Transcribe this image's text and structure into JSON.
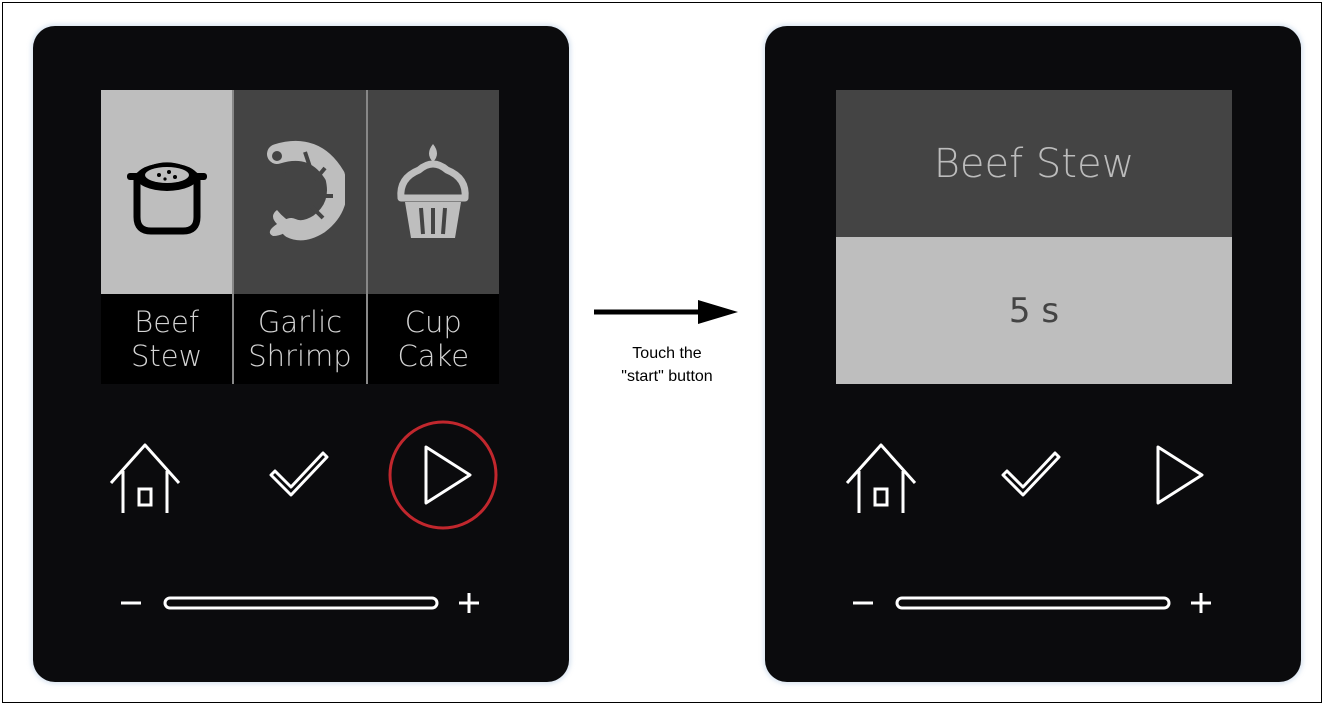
{
  "panel_before": {
    "menu_items": [
      {
        "line1": "Beef",
        "line2": "Stew",
        "icon": "pot-icon",
        "selected": true
      },
      {
        "line1": "Garlic",
        "line2": "Shrimp",
        "icon": "shrimp-icon",
        "selected": false
      },
      {
        "line1": "Cup",
        "line2": "Cake",
        "icon": "cupcake-icon",
        "selected": false
      }
    ],
    "highlighted_button": "start-button"
  },
  "transition": {
    "caption_line1": "Touch the",
    "caption_line2": "\"start\" button"
  },
  "panel_after": {
    "recipe_name": "Beef Stew",
    "remaining_time": "5 s"
  },
  "controls": {
    "buttons": [
      "home-icon",
      "check-icon",
      "play-icon"
    ],
    "slider_minus": "−",
    "slider_plus": "+"
  },
  "colors": {
    "highlight_ring": "#c1272d",
    "selected_tile": "#bebebe",
    "unselected_tile": "#444444",
    "device_body": "#0b0b0d"
  }
}
